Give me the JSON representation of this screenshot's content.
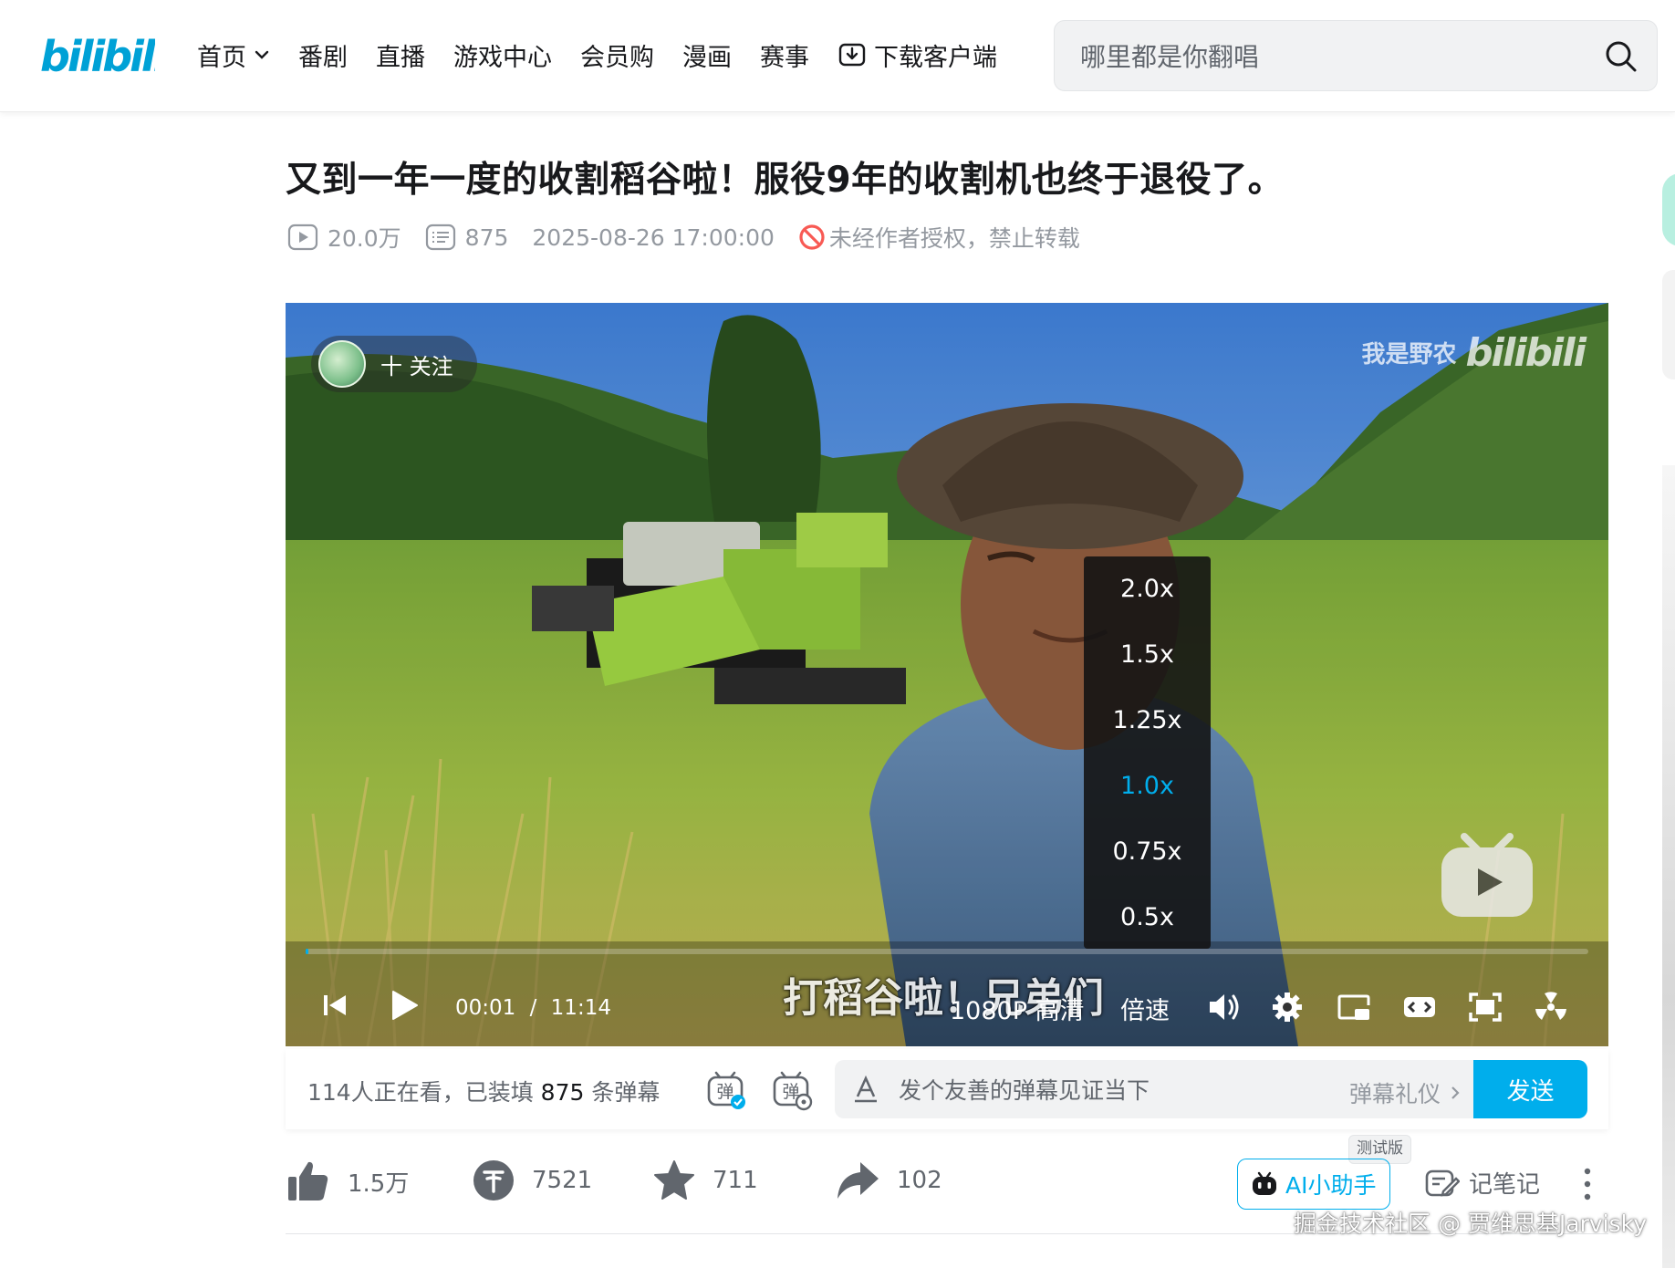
{
  "header": {
    "logo_text": "bilibili",
    "nav": [
      {
        "label": "首页",
        "has_dropdown": true
      },
      {
        "label": "番剧"
      },
      {
        "label": "直播"
      },
      {
        "label": "游戏中心"
      },
      {
        "label": "会员购"
      },
      {
        "label": "漫画"
      },
      {
        "label": "赛事"
      },
      {
        "label": "下载客户端",
        "icon": "download-icon"
      }
    ],
    "search": {
      "placeholder": "哪里都是你翻唱",
      "icon": "search-icon"
    }
  },
  "video_info": {
    "title": "又到一年一度的收割稻谷啦！服役9年的收割机也终于退役了。",
    "views": "20.0万",
    "danmaku": "875",
    "date": "2025-08-26 17:00:00",
    "copyright": "未经作者授权，禁止转载"
  },
  "player": {
    "follow_label": "十 关注",
    "watermark_text": "我是野农",
    "watermark_logo": "bilibili",
    "subtitle": "打稻谷啦！兄弟们",
    "time_current": "00:01",
    "time_separator": "/",
    "time_total": "11:14",
    "progress_fraction": 0.002,
    "quality": "1080P 高清",
    "speed_label": "倍速",
    "speed_options": [
      "2.0x",
      "1.5x",
      "1.25x",
      "1.0x",
      "0.75x",
      "0.5x"
    ],
    "speed_selected": "1.0x"
  },
  "danmaku_bar": {
    "watching_prefix": "114人正在看，已装填",
    "count": "875",
    "suffix": "条弹幕",
    "input_placeholder": "发个友善的弹幕见证当下",
    "gift_label": "弹幕礼仪",
    "send_label": "发送"
  },
  "actions": {
    "like": "1.5万",
    "coin": "7521",
    "favorite": "711",
    "share": "102",
    "ai_label": "AI小助手",
    "beta_label": "测试版",
    "note_label": "记笔记"
  },
  "credit": "掘金技术社区 @ 贾维思基Jarvisky",
  "colors": {
    "accent": "#00aeec",
    "text": "#18191c",
    "muted": "#9499a0",
    "warning": "#f85a54"
  }
}
